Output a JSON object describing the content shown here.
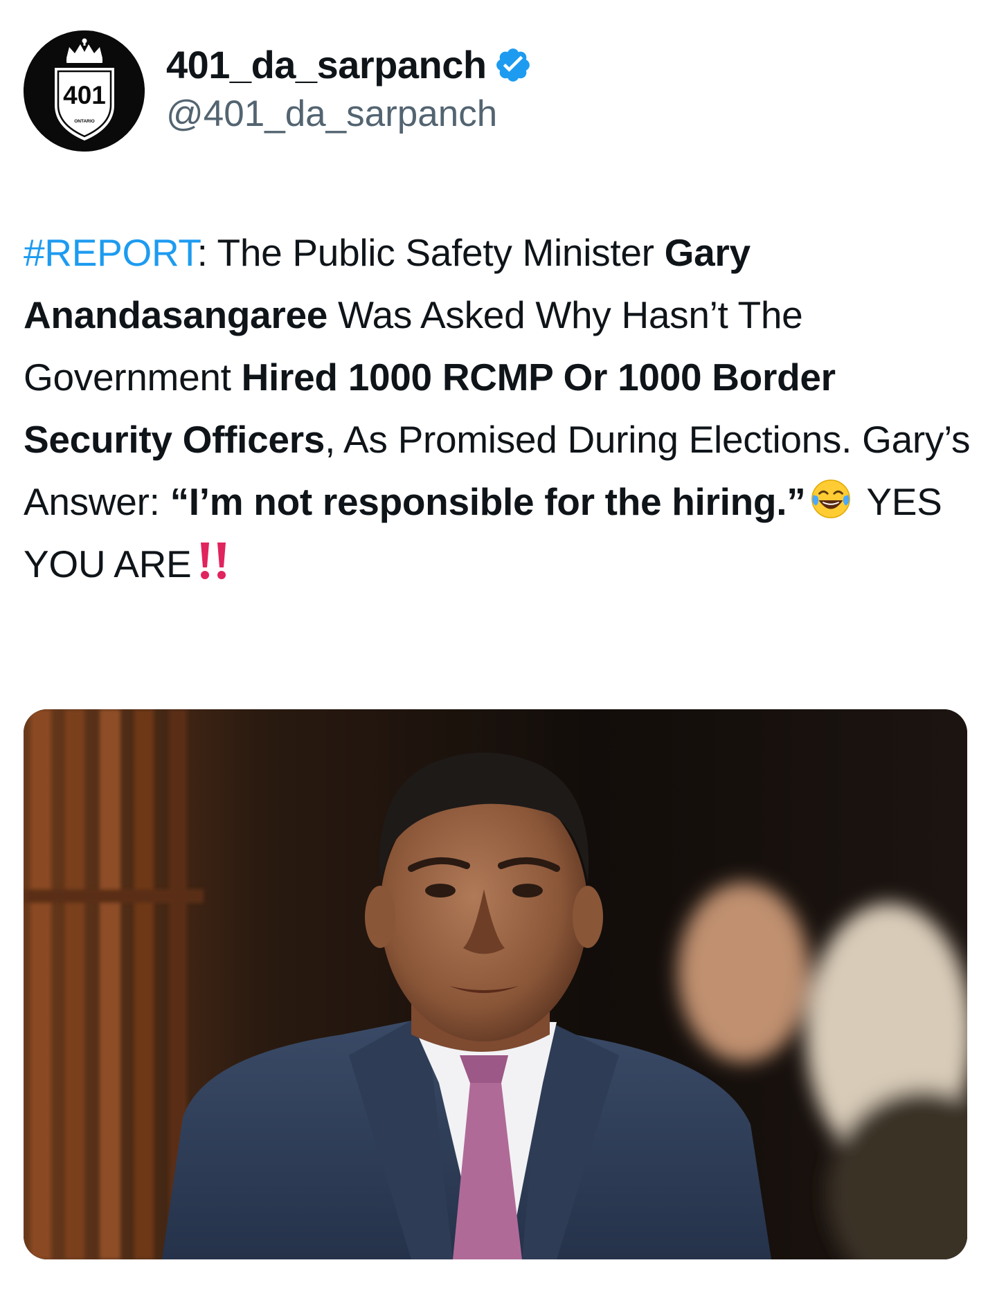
{
  "tweet": {
    "author": {
      "display_name": "401_da_sarpanch",
      "handle": "@401_da_sarpanch",
      "verified": true,
      "avatar": {
        "shield_number": "401",
        "shield_region": "ONTARIO",
        "icon": "highway-401-shield-icon"
      }
    },
    "text_segments": [
      {
        "id": "hashtag",
        "text": "#REPORT",
        "style": "link"
      },
      {
        "id": "s1",
        "text": ": The Public Safety Minister ",
        "style": "normal"
      },
      {
        "id": "s2",
        "text": "Gary Anandasangaree",
        "style": "bold"
      },
      {
        "id": "s3",
        "text": " Was Asked Why Hasn’t The Government ",
        "style": "normal"
      },
      {
        "id": "s4",
        "text": "Hired 1000 RCMP Or 1000 Border Security Officers",
        "style": "bold"
      },
      {
        "id": "s5",
        "text": ", As Promised During Elections. Gary’s Answer: ",
        "style": "normal"
      },
      {
        "id": "s6",
        "text": "“I’m not responsible for the hiring.”",
        "style": "bold"
      },
      {
        "id": "s7",
        "text": " YES YOU ARE",
        "style": "normal"
      }
    ],
    "emojis": [
      "tears-of-joy-emoji",
      "double-exclamation-emoji"
    ],
    "media": {
      "type": "photo",
      "icon": "photo-of-man-in-suit"
    }
  },
  "colors": {
    "text": "#0f1419",
    "secondary_text": "#536471",
    "link": "#1d9bf0",
    "verified": "#1d9bf0",
    "exclamation": "#e0245e"
  }
}
